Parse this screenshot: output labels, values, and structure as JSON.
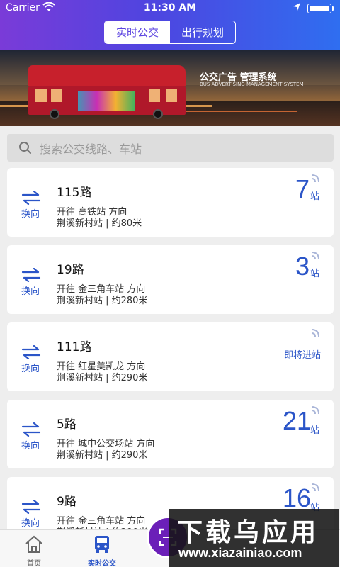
{
  "status_bar": {
    "carrier": "Carrier",
    "time": "11:30 AM"
  },
  "header": {
    "tabs": [
      {
        "label": "实时公交",
        "active": true
      },
      {
        "label": "出行规划",
        "active": false
      }
    ]
  },
  "banner": {
    "title": "公交广告 管理系统",
    "subtitle": "BUS ADVERTISING MANAGEMENT SYSTEM"
  },
  "search": {
    "placeholder": "搜索公交线路、车站"
  },
  "routes": [
    {
      "route": "115路",
      "direction": "开往 高铁站 方向",
      "stop": "荆溪新村站 | 约80米",
      "count": "7",
      "unit": "站",
      "swap_label": "换向"
    },
    {
      "route": "19路",
      "direction": "开往 金三角车站 方向",
      "stop": "荆溪新村站 | 约280米",
      "count": "3",
      "unit": "站",
      "swap_label": "换向"
    },
    {
      "route": "111路",
      "direction": "开往 红星美凯龙 方向",
      "stop": "荆溪新村站 | 约290米",
      "arriving": "即将进站",
      "swap_label": "换向"
    },
    {
      "route": "5路",
      "direction": "开往 城中公交场站 方向",
      "stop": "荆溪新村站 | 约290米",
      "count": "21",
      "unit": "站",
      "swap_label": "换向"
    },
    {
      "route": "9路",
      "direction": "开往 金三角车站 方向",
      "stop": "荆溪新村站 | 约290米",
      "count": "16",
      "unit": "站",
      "swap_label": "换向"
    }
  ],
  "tabbar": {
    "items": [
      {
        "label": "首页"
      },
      {
        "label": "实时公交",
        "active": true
      },
      {
        "label": ""
      },
      {
        "label": ""
      },
      {
        "label": ""
      }
    ]
  },
  "watermark": {
    "title": "下载乌应用",
    "url": "www.xiazainiao.com"
  },
  "colors": {
    "accent": "#2b55c8",
    "header_start": "#7a3bd8",
    "header_end": "#2f6ef0"
  }
}
